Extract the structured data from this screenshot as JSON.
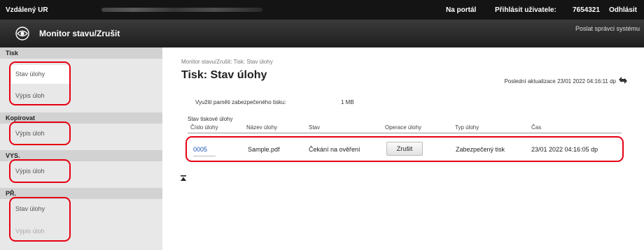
{
  "top": {
    "app": "Vzdálený UR",
    "portal": "Na portál",
    "login_label": "Přihlásit uživatele:",
    "user": "7654321",
    "logout": "Odhlásit"
  },
  "header": {
    "title": "Monitor stavu/Zrušit",
    "admin_link": "Poslat správci systému"
  },
  "sidebar": {
    "sections": [
      {
        "label": "Tisk",
        "items": [
          "Stav úlohy",
          "Výpis úloh"
        ]
      },
      {
        "label": "Kopírovat",
        "items": [
          "Výpis úloh"
        ]
      },
      {
        "label": "VYS.",
        "items": [
          "Výpis úloh"
        ]
      },
      {
        "label": "PŘ.",
        "items": [
          "Stav úlohy",
          "Výpis úloh"
        ]
      }
    ]
  },
  "main": {
    "breadcrumb": "Monitor stavu/Zrušit: Tisk: Stav úlohy",
    "title": "Tisk: Stav úlohy",
    "last_update": "Poslední aktualizace 23/01 2022 04:16:11 dp",
    "memory_label": "Využití paměti zabezpečeného tisku:",
    "memory_value": "1 MB",
    "table_title": "Stav tiskové úlohy",
    "columns": [
      "Číslo úlohy",
      "Název úlohy",
      "Stav",
      "Operace úlohy",
      "Typ úlohy",
      "Čas"
    ],
    "rows": [
      {
        "id": "0005",
        "name": "Sample.pdf",
        "status": "Čekání na ověření",
        "action": "Zrušit",
        "type": "Zabezpečený tisk",
        "time": "23/01 2022 04:16:05 dp"
      }
    ]
  },
  "colors": {
    "highlight": "#e60012",
    "topbar": "#141414",
    "link": "#1a55b5"
  }
}
